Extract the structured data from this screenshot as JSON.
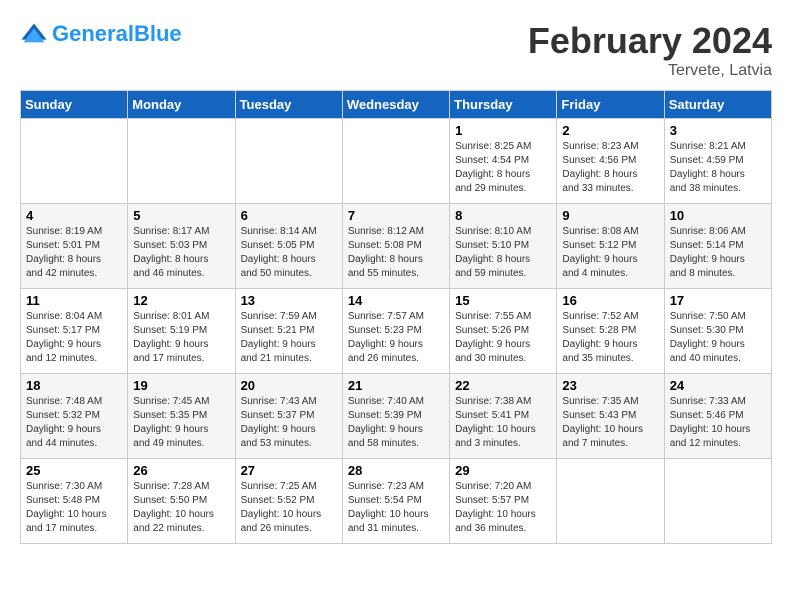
{
  "header": {
    "logo_general": "General",
    "logo_blue": "Blue",
    "main_title": "February 2024",
    "subtitle": "Tervete, Latvia"
  },
  "calendar": {
    "days_of_week": [
      "Sunday",
      "Monday",
      "Tuesday",
      "Wednesday",
      "Thursday",
      "Friday",
      "Saturday"
    ],
    "weeks": [
      [
        {
          "day": "",
          "info": ""
        },
        {
          "day": "",
          "info": ""
        },
        {
          "day": "",
          "info": ""
        },
        {
          "day": "",
          "info": ""
        },
        {
          "day": "1",
          "info": "Sunrise: 8:25 AM\nSunset: 4:54 PM\nDaylight: 8 hours\nand 29 minutes."
        },
        {
          "day": "2",
          "info": "Sunrise: 8:23 AM\nSunset: 4:56 PM\nDaylight: 8 hours\nand 33 minutes."
        },
        {
          "day": "3",
          "info": "Sunrise: 8:21 AM\nSunset: 4:59 PM\nDaylight: 8 hours\nand 38 minutes."
        }
      ],
      [
        {
          "day": "4",
          "info": "Sunrise: 8:19 AM\nSunset: 5:01 PM\nDaylight: 8 hours\nand 42 minutes."
        },
        {
          "day": "5",
          "info": "Sunrise: 8:17 AM\nSunset: 5:03 PM\nDaylight: 8 hours\nand 46 minutes."
        },
        {
          "day": "6",
          "info": "Sunrise: 8:14 AM\nSunset: 5:05 PM\nDaylight: 8 hours\nand 50 minutes."
        },
        {
          "day": "7",
          "info": "Sunrise: 8:12 AM\nSunset: 5:08 PM\nDaylight: 8 hours\nand 55 minutes."
        },
        {
          "day": "8",
          "info": "Sunrise: 8:10 AM\nSunset: 5:10 PM\nDaylight: 8 hours\nand 59 minutes."
        },
        {
          "day": "9",
          "info": "Sunrise: 8:08 AM\nSunset: 5:12 PM\nDaylight: 9 hours\nand 4 minutes."
        },
        {
          "day": "10",
          "info": "Sunrise: 8:06 AM\nSunset: 5:14 PM\nDaylight: 9 hours\nand 8 minutes."
        }
      ],
      [
        {
          "day": "11",
          "info": "Sunrise: 8:04 AM\nSunset: 5:17 PM\nDaylight: 9 hours\nand 12 minutes."
        },
        {
          "day": "12",
          "info": "Sunrise: 8:01 AM\nSunset: 5:19 PM\nDaylight: 9 hours\nand 17 minutes."
        },
        {
          "day": "13",
          "info": "Sunrise: 7:59 AM\nSunset: 5:21 PM\nDaylight: 9 hours\nand 21 minutes."
        },
        {
          "day": "14",
          "info": "Sunrise: 7:57 AM\nSunset: 5:23 PM\nDaylight: 9 hours\nand 26 minutes."
        },
        {
          "day": "15",
          "info": "Sunrise: 7:55 AM\nSunset: 5:26 PM\nDaylight: 9 hours\nand 30 minutes."
        },
        {
          "day": "16",
          "info": "Sunrise: 7:52 AM\nSunset: 5:28 PM\nDaylight: 9 hours\nand 35 minutes."
        },
        {
          "day": "17",
          "info": "Sunrise: 7:50 AM\nSunset: 5:30 PM\nDaylight: 9 hours\nand 40 minutes."
        }
      ],
      [
        {
          "day": "18",
          "info": "Sunrise: 7:48 AM\nSunset: 5:32 PM\nDaylight: 9 hours\nand 44 minutes."
        },
        {
          "day": "19",
          "info": "Sunrise: 7:45 AM\nSunset: 5:35 PM\nDaylight: 9 hours\nand 49 minutes."
        },
        {
          "day": "20",
          "info": "Sunrise: 7:43 AM\nSunset: 5:37 PM\nDaylight: 9 hours\nand 53 minutes."
        },
        {
          "day": "21",
          "info": "Sunrise: 7:40 AM\nSunset: 5:39 PM\nDaylight: 9 hours\nand 58 minutes."
        },
        {
          "day": "22",
          "info": "Sunrise: 7:38 AM\nSunset: 5:41 PM\nDaylight: 10 hours\nand 3 minutes."
        },
        {
          "day": "23",
          "info": "Sunrise: 7:35 AM\nSunset: 5:43 PM\nDaylight: 10 hours\nand 7 minutes."
        },
        {
          "day": "24",
          "info": "Sunrise: 7:33 AM\nSunset: 5:46 PM\nDaylight: 10 hours\nand 12 minutes."
        }
      ],
      [
        {
          "day": "25",
          "info": "Sunrise: 7:30 AM\nSunset: 5:48 PM\nDaylight: 10 hours\nand 17 minutes."
        },
        {
          "day": "26",
          "info": "Sunrise: 7:28 AM\nSunset: 5:50 PM\nDaylight: 10 hours\nand 22 minutes."
        },
        {
          "day": "27",
          "info": "Sunrise: 7:25 AM\nSunset: 5:52 PM\nDaylight: 10 hours\nand 26 minutes."
        },
        {
          "day": "28",
          "info": "Sunrise: 7:23 AM\nSunset: 5:54 PM\nDaylight: 10 hours\nand 31 minutes."
        },
        {
          "day": "29",
          "info": "Sunrise: 7:20 AM\nSunset: 5:57 PM\nDaylight: 10 hours\nand 36 minutes."
        },
        {
          "day": "",
          "info": ""
        },
        {
          "day": "",
          "info": ""
        }
      ]
    ]
  }
}
